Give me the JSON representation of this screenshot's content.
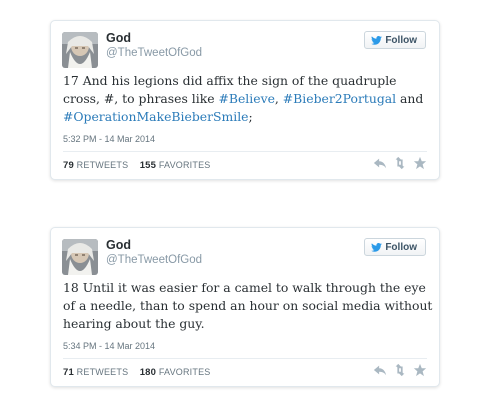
{
  "colors": {
    "link": "#2b7bb9",
    "muted": "#66757f",
    "border": "#e1e8ed"
  },
  "tweets": [
    {
      "name": "God",
      "handle": "@TheTweetOfGod",
      "follow_label": "Follow",
      "text_parts": [
        "17 And his legions did affix the sign of the quadruple cross, #, to phrases like ",
        "#Believe",
        ", ",
        "#Bieber2Portugal",
        " and ",
        "#OperationMakeBieberSmile",
        ";"
      ],
      "timestamp": "5:32 PM - 14 Mar 2014",
      "retweets_count": "79",
      "retweets_label": "RETWEETS",
      "favorites_count": "155",
      "favorites_label": "FAVORITES"
    },
    {
      "name": "God",
      "handle": "@TheTweetOfGod",
      "follow_label": "Follow",
      "text": "18 Until it was easier for a camel to walk through the eye of a needle, than to spend an hour on social media without hearing about the guy.",
      "timestamp": "5:34 PM - 14 Mar 2014",
      "retweets_count": "71",
      "retweets_label": "RETWEETS",
      "favorites_count": "180",
      "favorites_label": "FAVORITES"
    }
  ],
  "icons": {
    "follow": "twitter-bird-icon",
    "reply": "reply-icon",
    "retweet": "retweet-icon",
    "favorite": "star-icon"
  }
}
